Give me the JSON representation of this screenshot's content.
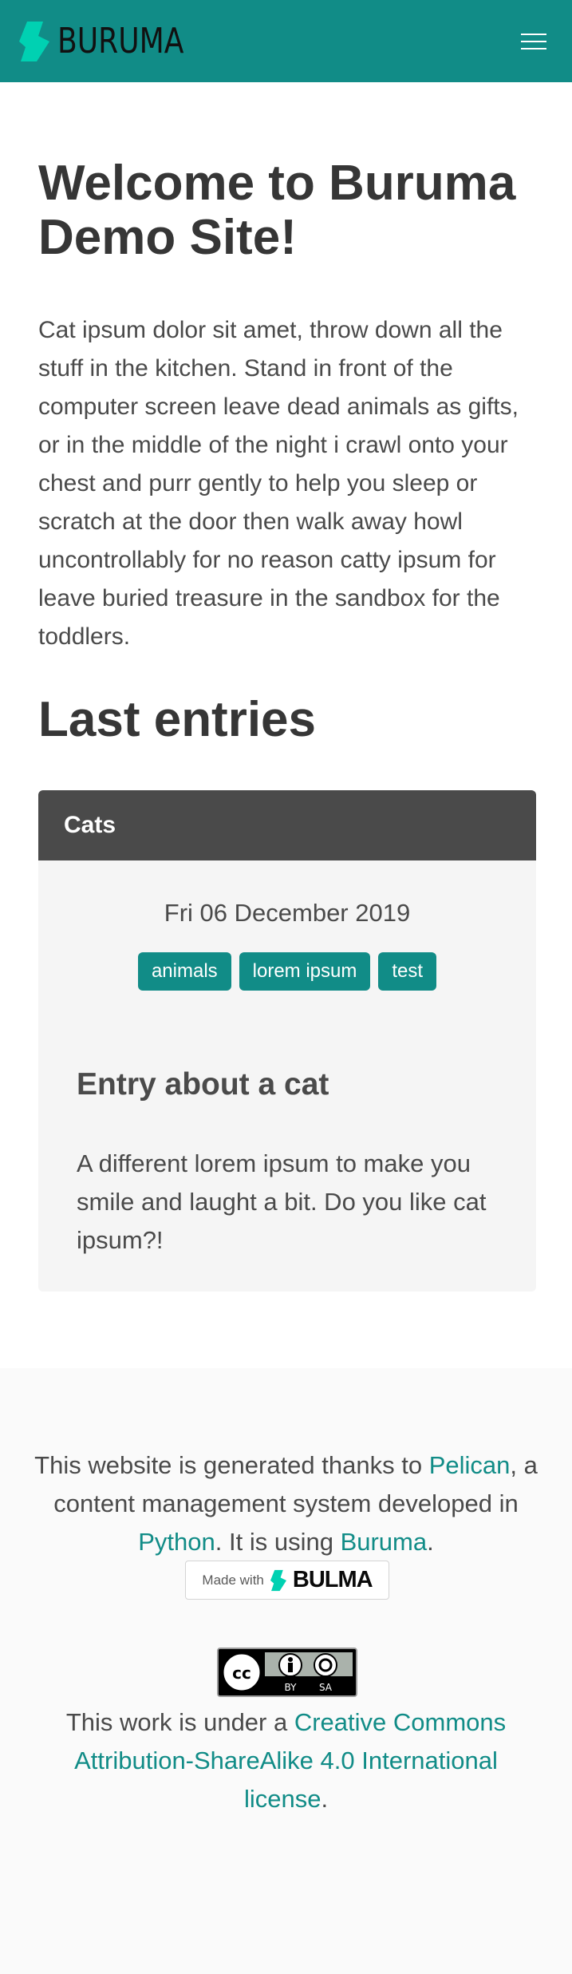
{
  "navbar": {
    "brand": "BURUMA",
    "brand_color": "#118c87",
    "logo_icon": "buruma-logo-icon",
    "menu_icon": "hamburger-menu-icon"
  },
  "hero": {
    "title": "Welcome to Buruma Demo Site!",
    "text": "Cat ipsum dolor sit amet, throw down all the stuff in the kitchen. Stand in front of the computer screen leave dead animals as gifts, or in the middle of the night i crawl onto your chest and purr gently to help you sleep or scratch at the door then walk away howl uncontrollably for no reason catty ipsum for leave buried treasure in the sandbox for the toddlers."
  },
  "entries": {
    "section_title": "Last entries",
    "card": {
      "category": "Cats",
      "date": "Fri 06 December 2019",
      "tags": [
        "animals",
        "lorem ipsum",
        "test"
      ],
      "title": "Entry about a cat",
      "summary": "A different lorem ipsum to make you smile and laught a bit. Do you like cat ipsum?!"
    }
  },
  "footer": {
    "line_prefix": "This website is generated thanks to ",
    "pelican": "Pelican",
    "line_middle": ", a content management system developed in ",
    "python": "Python",
    "line_suffix": ". It is using ",
    "buruma": "Buruma",
    "period": ".",
    "bulma_badge": {
      "made_with": "Made with",
      "name": "BULMA"
    },
    "cc_badge": {
      "by": "BY",
      "sa": "SA"
    },
    "license_prefix": "This work is under a ",
    "license_link": "Creative Commons Attribution-ShareAlike 4.0 International license",
    "license_suffix": "."
  }
}
